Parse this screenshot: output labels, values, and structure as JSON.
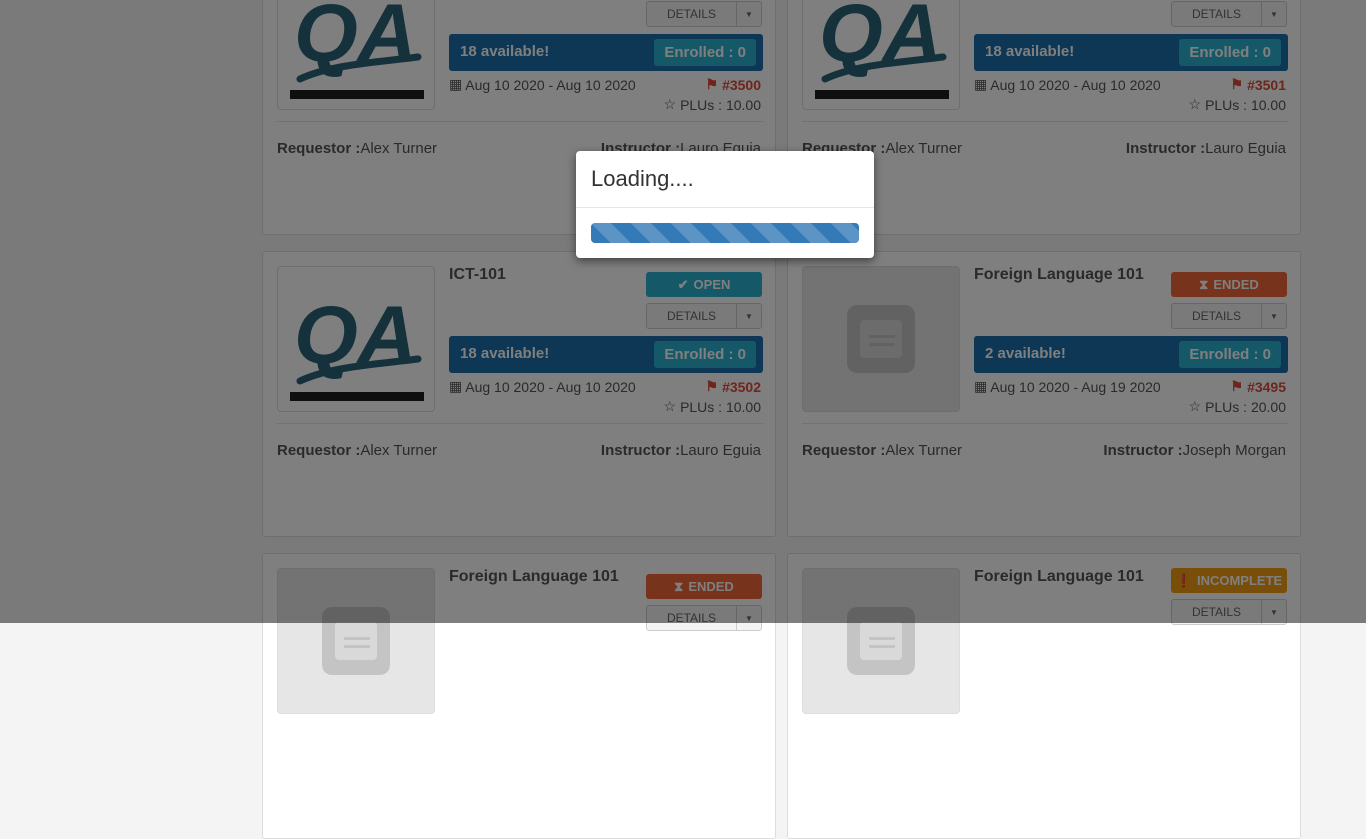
{
  "cards": [
    {
      "title": "",
      "status": "",
      "details_label": "DETAILS",
      "available": "18 available!",
      "enrolled": "Enrolled : 0",
      "date_range": "Aug 10 2020 - Aug 10 2020",
      "course_number": "#3500",
      "plus": "PLUs : 10.00",
      "requestor_label": "Requestor :",
      "requestor": "Alex Turner",
      "instructor_label": "Instructor :",
      "instructor": "Lauro Eguia",
      "thumbnail": "qa-logo"
    },
    {
      "title": "",
      "status": "",
      "details_label": "DETAILS",
      "available": "18 available!",
      "enrolled": "Enrolled : 0",
      "date_range": "Aug 10 2020 - Aug 10 2020",
      "course_number": "#3501",
      "plus": "PLUs : 10.00",
      "requestor_label": "Requestor :",
      "requestor": "Alex Turner",
      "instructor_label": "Instructor :",
      "instructor": "Lauro Eguia",
      "thumbnail": "qa-logo"
    },
    {
      "title": "ICT-101",
      "status": "OPEN",
      "status_icon": "check-icon",
      "details_label": "DETAILS",
      "available": "18 available!",
      "enrolled": "Enrolled : 0",
      "date_range": "Aug 10 2020 - Aug 10 2020",
      "course_number": "#3502",
      "plus": "PLUs : 10.00",
      "requestor_label": "Requestor :",
      "requestor": "Alex Turner",
      "instructor_label": "Instructor :",
      "instructor": "Lauro Eguia",
      "thumbnail": "qa-logo"
    },
    {
      "title": "Foreign Language 101",
      "status": "ENDED",
      "status_icon": "hourglass-icon",
      "details_label": "DETAILS",
      "available": "2 available!",
      "enrolled": "Enrolled : 0",
      "date_range": "Aug 10 2020 - Aug 19 2020",
      "course_number": "#3495",
      "plus": "PLUs : 20.00",
      "requestor_label": "Requestor :",
      "requestor": "Alex Turner",
      "instructor_label": "Instructor :",
      "instructor": "Joseph Morgan",
      "thumbnail": "book-placeholder"
    },
    {
      "title": "Foreign Language 101",
      "status": "ENDED",
      "status_icon": "hourglass-icon",
      "details_label": "DETAILS",
      "thumbnail": "book-placeholder"
    },
    {
      "title": "Foreign Language 101",
      "status": "INCOMPLETE",
      "status_icon": "exclamation-circle-icon",
      "details_label": "DETAILS",
      "thumbnail": "book-placeholder"
    }
  ],
  "modal": {
    "title": "Loading....",
    "progress": 1.0
  },
  "colors": {
    "available_bar": "#1a6fa8",
    "enrolled_badge": "#2bb3d3",
    "status_open": "#2bb3d3",
    "status_ended": "#f0663a",
    "status_incomplete": "#f39c12",
    "course_number": "#dd4b39",
    "progress_bar": "#337ab7"
  }
}
